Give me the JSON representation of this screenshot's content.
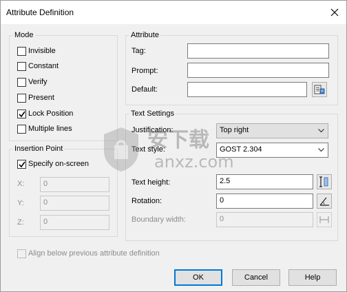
{
  "window": {
    "title": "Attribute Definition"
  },
  "mode": {
    "title": "Mode",
    "items": [
      {
        "label": "Invisible",
        "checked": false
      },
      {
        "label": "Constant",
        "checked": false
      },
      {
        "label": "Verify",
        "checked": false
      },
      {
        "label": "Present",
        "checked": false
      },
      {
        "label": "Lock Position",
        "checked": true
      },
      {
        "label": "Multiple lines",
        "checked": false
      }
    ]
  },
  "insertion": {
    "title": "Insertion Point",
    "specify_label": "Specify on-screen",
    "specify_checked": true,
    "x_label": "X:",
    "x_value": "0",
    "y_label": "Y:",
    "y_value": "0",
    "z_label": "Z:",
    "z_value": "0"
  },
  "attribute": {
    "title": "Attribute",
    "tag_label": "Tag:",
    "tag_value": "",
    "prompt_label": "Prompt:",
    "prompt_value": "",
    "default_label": "Default:",
    "default_value": ""
  },
  "text_settings": {
    "title": "Text Settings",
    "justification_label": "Justification:",
    "justification_value": "Top right",
    "text_style_label": "Text style:",
    "text_style_value": "GOST 2.304",
    "text_height_label": "Text height:",
    "text_height_value": "2.5",
    "rotation_label": "Rotation:",
    "rotation_value": "0",
    "boundary_width_label": "Boundary width:",
    "boundary_width_value": "0"
  },
  "align_label": "Align below previous attribute definition",
  "buttons": {
    "ok": "OK",
    "cancel": "Cancel",
    "help": "Help"
  },
  "watermark": {
    "brand": "安下载",
    "domain": "anxz.com"
  }
}
